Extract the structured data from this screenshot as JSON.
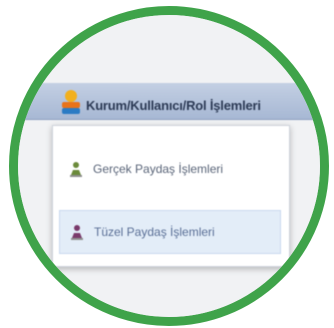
{
  "menubar": {
    "title": "Kurum/Kullanıcı/Rol İşlemleri"
  },
  "dropdown": {
    "items": [
      {
        "label": "Gerçek Paydaş İşlemleri",
        "icon": "person-download-icon",
        "selected": false
      },
      {
        "label": "Tüzel Paydaş İşlemleri",
        "icon": "person-download-icon",
        "selected": true
      }
    ]
  },
  "colors": {
    "ring": "#3fa34a",
    "menubar": "#b4c3db",
    "selected_item": "#e3edf8"
  }
}
